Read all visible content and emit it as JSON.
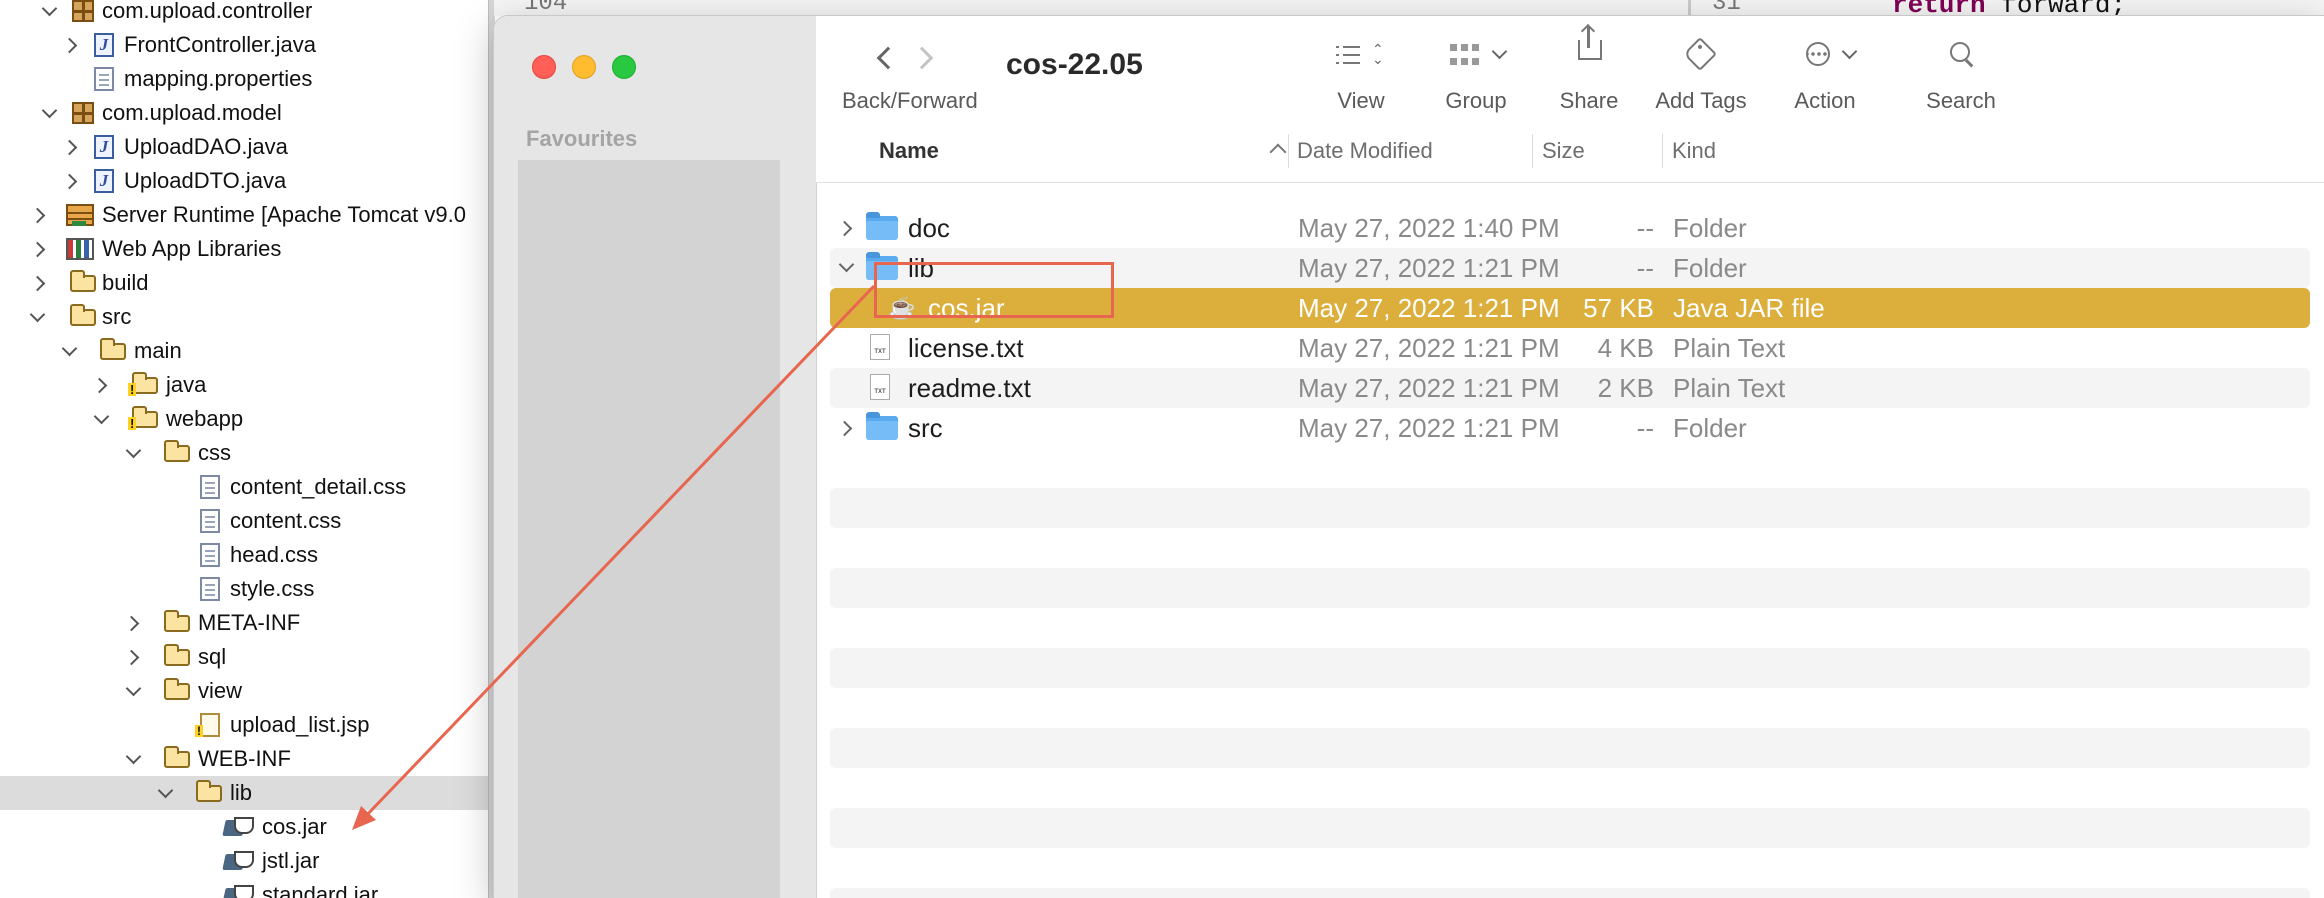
{
  "tree": {
    "items": [
      {
        "label": "com.upload.controller",
        "icon": "package-icon"
      },
      {
        "label": "FrontController.java",
        "icon": "java-file-icon"
      },
      {
        "label": "mapping.properties",
        "icon": "properties-file-icon"
      },
      {
        "label": "com.upload.model",
        "icon": "package-icon"
      },
      {
        "label": "UploadDAO.java",
        "icon": "java-file-icon"
      },
      {
        "label": "UploadDTO.java",
        "icon": "java-file-icon"
      },
      {
        "label": "Server Runtime [Apache Tomcat v9.0",
        "icon": "server-runtime-icon"
      },
      {
        "label": "Web App Libraries",
        "icon": "library-icon"
      },
      {
        "label": "build",
        "icon": "folder-icon"
      },
      {
        "label": "src",
        "icon": "folder-icon"
      },
      {
        "label": "main",
        "icon": "folder-icon"
      },
      {
        "label": "java",
        "icon": "folder-warning-icon"
      },
      {
        "label": "webapp",
        "icon": "folder-warning-icon"
      },
      {
        "label": "css",
        "icon": "folder-icon"
      },
      {
        "label": "content_detail.css",
        "icon": "css-file-icon"
      },
      {
        "label": "content.css",
        "icon": "css-file-icon"
      },
      {
        "label": "head.css",
        "icon": "css-file-icon"
      },
      {
        "label": "style.css",
        "icon": "css-file-icon"
      },
      {
        "label": "META-INF",
        "icon": "folder-icon"
      },
      {
        "label": "sql",
        "icon": "folder-icon"
      },
      {
        "label": "view",
        "icon": "folder-icon"
      },
      {
        "label": "upload_list.jsp",
        "icon": "jsp-file-icon"
      },
      {
        "label": "WEB-INF",
        "icon": "folder-icon"
      },
      {
        "label": "lib",
        "icon": "folder-icon"
      },
      {
        "label": "cos.jar",
        "icon": "jar-file-icon"
      },
      {
        "label": "jstl.jar",
        "icon": "jar-file-icon"
      },
      {
        "label": "standard.jar",
        "icon": "jar-file-icon"
      }
    ]
  },
  "editor": {
    "line_left": "104",
    "line_right": "31",
    "code_keyword": "return",
    "code_rest": " forward;"
  },
  "finder": {
    "title": "cos-22.05",
    "sidebar": {
      "favourites": "Favourites"
    },
    "toolbar": {
      "back_forward": "Back/Forward",
      "view": "View",
      "group": "Group",
      "share": "Share",
      "add_tags": "Add Tags",
      "action": "Action",
      "search": "Search"
    },
    "columns": {
      "name": "Name",
      "date": "Date Modified",
      "size": "Size",
      "kind": "Kind"
    },
    "rows": [
      {
        "name": "doc",
        "date": "May 27, 2022 1:40 PM",
        "size": "--",
        "kind": "Folder",
        "icon": "folder-icon"
      },
      {
        "name": "lib",
        "date": "May 27, 2022 1:21 PM",
        "size": "--",
        "kind": "Folder",
        "icon": "folder-icon"
      },
      {
        "name": "cos.jar",
        "date": "May 27, 2022 1:21 PM",
        "size": "57 KB",
        "kind": "Java JAR file",
        "icon": "java-jar-icon"
      },
      {
        "name": "license.txt",
        "date": "May 27, 2022 1:21 PM",
        "size": "4 KB",
        "kind": "Plain Text",
        "icon": "text-file-icon"
      },
      {
        "name": "readme.txt",
        "date": "May 27, 2022 1:21 PM",
        "size": "2 KB",
        "kind": "Plain Text",
        "icon": "text-file-icon"
      },
      {
        "name": "src",
        "date": "May 27, 2022 1:21 PM",
        "size": "--",
        "kind": "Folder",
        "icon": "folder-icon"
      }
    ],
    "txt_badge": "TXT"
  },
  "colors": {
    "selection": "#dcaf3c",
    "annotation": "#e8664f",
    "folder_blue": "#5aaaf0"
  }
}
